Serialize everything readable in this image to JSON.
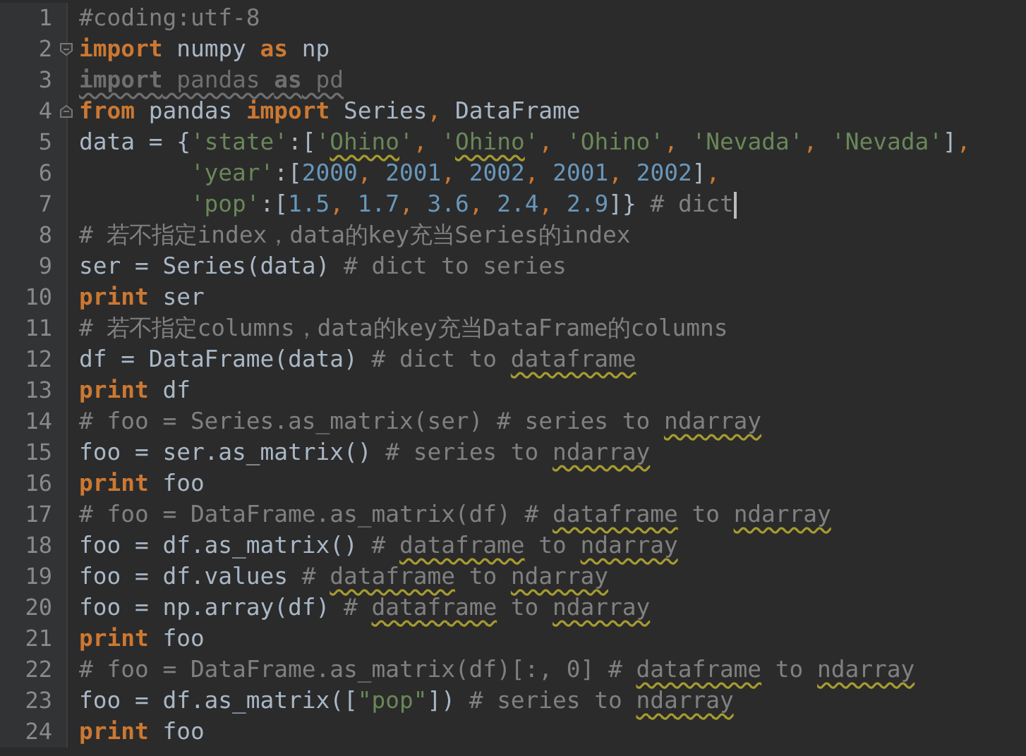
{
  "editor": {
    "lines": [
      {
        "number": "1",
        "tokens": [
          {
            "kind": "comment",
            "text": "#coding:utf-8"
          }
        ]
      },
      {
        "number": "2",
        "fold_open": true,
        "tokens": [
          {
            "kind": "keyword",
            "text": "import"
          },
          {
            "kind": "plain",
            "text": " numpy "
          },
          {
            "kind": "keyword",
            "text": "as"
          },
          {
            "kind": "plain",
            "text": " np"
          }
        ]
      },
      {
        "number": "3",
        "tokens": [
          {
            "kind": "unused_keyword",
            "text": "import"
          },
          {
            "kind": "unused",
            "text": " pandas "
          },
          {
            "kind": "unused_keyword",
            "text": "as"
          },
          {
            "kind": "unused",
            "text": " pd"
          }
        ]
      },
      {
        "number": "4",
        "fold_close": true,
        "tokens": [
          {
            "kind": "keyword",
            "text": "from"
          },
          {
            "kind": "plain",
            "text": " pandas "
          },
          {
            "kind": "keyword",
            "text": "import"
          },
          {
            "kind": "plain",
            "text": " Series"
          },
          {
            "kind": "punct",
            "text": ","
          },
          {
            "kind": "plain",
            "text": " DataFrame"
          }
        ]
      },
      {
        "number": "5",
        "tokens": [
          {
            "kind": "plain",
            "text": "data = {"
          },
          {
            "kind": "string",
            "text": "'state'"
          },
          {
            "kind": "plain",
            "text": ":["
          },
          {
            "kind": "string",
            "text": "'"
          },
          {
            "kind": "string_flagged",
            "text": "Ohino"
          },
          {
            "kind": "string",
            "text": "'"
          },
          {
            "kind": "punct",
            "text": ", "
          },
          {
            "kind": "string",
            "text": "'"
          },
          {
            "kind": "string_flagged",
            "text": "Ohino"
          },
          {
            "kind": "string",
            "text": "'"
          },
          {
            "kind": "punct",
            "text": ", "
          },
          {
            "kind": "string",
            "text": "'Ohino'"
          },
          {
            "kind": "punct",
            "text": ", "
          },
          {
            "kind": "string",
            "text": "'Nevada'"
          },
          {
            "kind": "punct",
            "text": ", "
          },
          {
            "kind": "string",
            "text": "'Nevada'"
          },
          {
            "kind": "plain",
            "text": "]"
          },
          {
            "kind": "punct",
            "text": ","
          }
        ]
      },
      {
        "number": "6",
        "tokens": [
          {
            "kind": "string",
            "text": "        'year'"
          },
          {
            "kind": "plain",
            "text": ":["
          },
          {
            "kind": "number",
            "text": "2000"
          },
          {
            "kind": "punct",
            "text": ", "
          },
          {
            "kind": "number",
            "text": "2001"
          },
          {
            "kind": "punct",
            "text": ", "
          },
          {
            "kind": "number",
            "text": "2002"
          },
          {
            "kind": "punct",
            "text": ", "
          },
          {
            "kind": "number",
            "text": "2001"
          },
          {
            "kind": "punct",
            "text": ", "
          },
          {
            "kind": "number",
            "text": "2002"
          },
          {
            "kind": "plain",
            "text": "]"
          },
          {
            "kind": "punct",
            "text": ","
          }
        ]
      },
      {
        "number": "7",
        "caret": true,
        "tokens": [
          {
            "kind": "string",
            "text": "        'pop'"
          },
          {
            "kind": "plain",
            "text": ":["
          },
          {
            "kind": "number",
            "text": "1.5"
          },
          {
            "kind": "punct",
            "text": ", "
          },
          {
            "kind": "number",
            "text": "1.7"
          },
          {
            "kind": "punct",
            "text": ", "
          },
          {
            "kind": "number",
            "text": "3.6"
          },
          {
            "kind": "punct",
            "text": ", "
          },
          {
            "kind": "number",
            "text": "2.4"
          },
          {
            "kind": "punct",
            "text": ", "
          },
          {
            "kind": "number",
            "text": "2.9"
          },
          {
            "kind": "plain",
            "text": "]} "
          },
          {
            "kind": "comment",
            "text": "# dict"
          }
        ]
      },
      {
        "number": "8",
        "tokens": [
          {
            "kind": "comment",
            "text": "# 若不指定index，data的key充当Series的index"
          }
        ]
      },
      {
        "number": "9",
        "tokens": [
          {
            "kind": "plain",
            "text": "ser = Series(data) "
          },
          {
            "kind": "comment",
            "text": "# dict to series"
          }
        ]
      },
      {
        "number": "10",
        "tokens": [
          {
            "kind": "keyword",
            "text": "print"
          },
          {
            "kind": "plain",
            "text": " ser"
          }
        ]
      },
      {
        "number": "11",
        "tokens": [
          {
            "kind": "comment",
            "text": "# 若不指定columns，data的key充当DataFrame的columns"
          }
        ]
      },
      {
        "number": "12",
        "tokens": [
          {
            "kind": "plain",
            "text": "df = DataFrame(data) "
          },
          {
            "kind": "comment",
            "text": "# dict to "
          },
          {
            "kind": "comment_flagged",
            "text": "dataframe"
          }
        ]
      },
      {
        "number": "13",
        "tokens": [
          {
            "kind": "keyword",
            "text": "print"
          },
          {
            "kind": "plain",
            "text": " df"
          }
        ]
      },
      {
        "number": "14",
        "tokens": [
          {
            "kind": "comment",
            "text": "# foo = Series.as_matrix(ser) # series to "
          },
          {
            "kind": "comment_flagged",
            "text": "ndarray"
          }
        ]
      },
      {
        "number": "15",
        "tokens": [
          {
            "kind": "plain",
            "text": "foo = ser.as_matrix() "
          },
          {
            "kind": "comment",
            "text": "# series to "
          },
          {
            "kind": "comment_flagged",
            "text": "ndarray"
          }
        ]
      },
      {
        "number": "16",
        "tokens": [
          {
            "kind": "keyword",
            "text": "print"
          },
          {
            "kind": "plain",
            "text": " foo"
          }
        ]
      },
      {
        "number": "17",
        "tokens": [
          {
            "kind": "comment",
            "text": "# foo = DataFrame.as_matrix(df) # "
          },
          {
            "kind": "comment_flagged",
            "text": "dataframe"
          },
          {
            "kind": "comment",
            "text": " to "
          },
          {
            "kind": "comment_flagged",
            "text": "ndarray"
          }
        ]
      },
      {
        "number": "18",
        "tokens": [
          {
            "kind": "plain",
            "text": "foo = df.as_matrix() "
          },
          {
            "kind": "comment",
            "text": "# "
          },
          {
            "kind": "comment_flagged",
            "text": "dataframe"
          },
          {
            "kind": "comment",
            "text": " to "
          },
          {
            "kind": "comment_flagged",
            "text": "ndarray"
          }
        ]
      },
      {
        "number": "19",
        "tokens": [
          {
            "kind": "plain",
            "text": "foo = df.values "
          },
          {
            "kind": "comment",
            "text": "# "
          },
          {
            "kind": "comment_flagged",
            "text": "dataframe"
          },
          {
            "kind": "comment",
            "text": " to "
          },
          {
            "kind": "comment_flagged",
            "text": "ndarray"
          }
        ]
      },
      {
        "number": "20",
        "tokens": [
          {
            "kind": "plain",
            "text": "foo = np.array(df) "
          },
          {
            "kind": "comment",
            "text": "# "
          },
          {
            "kind": "comment_flagged",
            "text": "dataframe"
          },
          {
            "kind": "comment",
            "text": " to "
          },
          {
            "kind": "comment_flagged",
            "text": "ndarray"
          }
        ]
      },
      {
        "number": "21",
        "tokens": [
          {
            "kind": "keyword",
            "text": "print"
          },
          {
            "kind": "plain",
            "text": " foo"
          }
        ]
      },
      {
        "number": "22",
        "tokens": [
          {
            "kind": "comment",
            "text": "# foo = DataFrame.as_matrix(df)[:, 0] # "
          },
          {
            "kind": "comment_flagged",
            "text": "dataframe"
          },
          {
            "kind": "comment",
            "text": " to "
          },
          {
            "kind": "comment_flagged",
            "text": "ndarray"
          }
        ]
      },
      {
        "number": "23",
        "tokens": [
          {
            "kind": "plain",
            "text": "foo = df.as_matrix(["
          },
          {
            "kind": "string",
            "text": "\"pop\""
          },
          {
            "kind": "plain",
            "text": "]) "
          },
          {
            "kind": "comment",
            "text": "# series to "
          },
          {
            "kind": "comment_flagged",
            "text": "ndarray"
          }
        ]
      },
      {
        "number": "24",
        "tokens": [
          {
            "kind": "keyword",
            "text": "print"
          },
          {
            "kind": "plain",
            "text": " foo"
          }
        ]
      }
    ]
  }
}
